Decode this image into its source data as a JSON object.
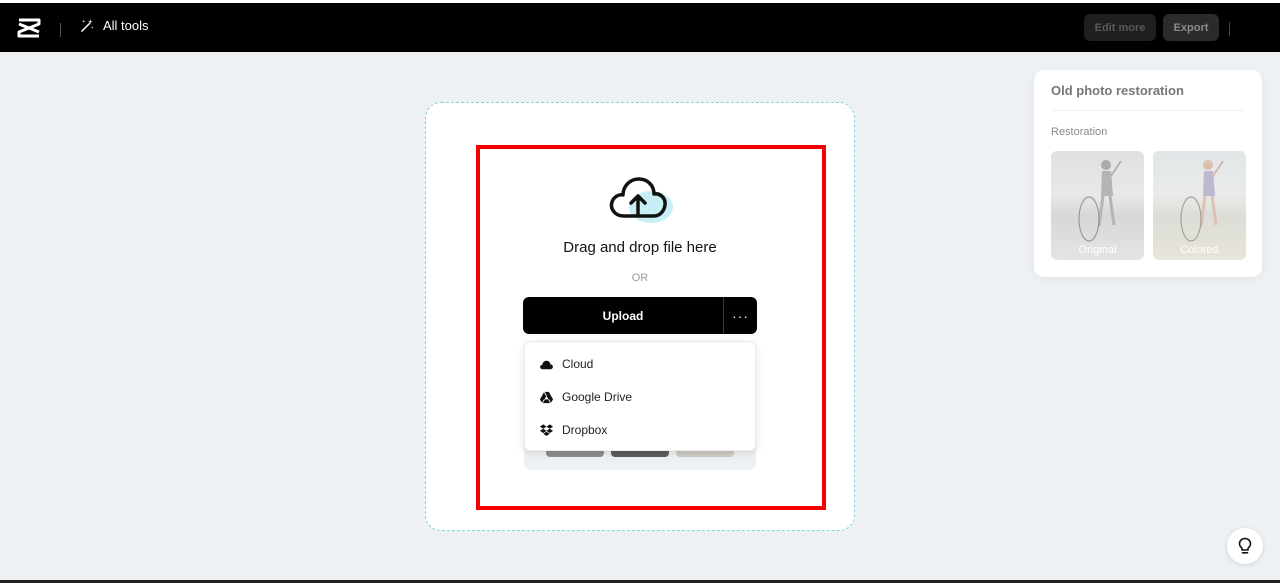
{
  "header": {
    "all_tools_label": "All tools",
    "edit_more_label": "Edit more",
    "export_label": "Export"
  },
  "upload_area": {
    "drag_text": "Drag and drop file here",
    "or_text": "OR",
    "upload_label": "Upload",
    "more_label": "···",
    "menu": [
      {
        "label": "Cloud",
        "icon": "cloud-icon"
      },
      {
        "label": "Google Drive",
        "icon": "google-drive-icon"
      },
      {
        "label": "Dropbox",
        "icon": "dropbox-icon"
      }
    ]
  },
  "side_panel": {
    "title": "Old photo restoration",
    "section": "Restoration",
    "samples": [
      {
        "label": "Original"
      },
      {
        "label": "Colored"
      }
    ]
  },
  "colors": {
    "accent_dashed": "#7fd4dd",
    "highlight": "#f20000",
    "cloud_fill": "#c7eef4"
  }
}
